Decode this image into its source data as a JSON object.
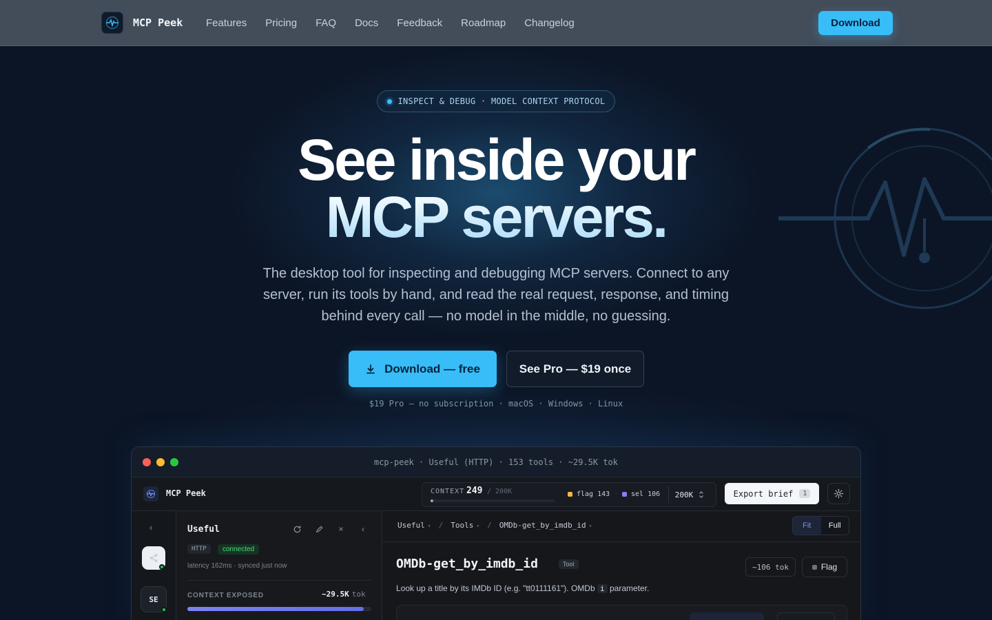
{
  "nav": {
    "brand": "MCP Peek",
    "links": [
      "Features",
      "Pricing",
      "FAQ",
      "Docs",
      "Feedback",
      "Roadmap",
      "Changelog"
    ],
    "download": "Download"
  },
  "hero": {
    "pill": "INSPECT & DEBUG · MODEL CONTEXT PROTOCOL",
    "title_line1": "See inside your",
    "title_line2": "MCP servers.",
    "subtitle": "The desktop tool for inspecting and debugging MCP servers. Connect to any server, run its tools by hand, and read the real request, response, and timing behind every call — no model in the middle, no guessing.",
    "cta_primary": "Download — free",
    "cta_secondary": "See Pro — $19 once",
    "fine_print": "$19 Pro — no subscription · macOS · Windows · Linux"
  },
  "app": {
    "title": "mcp-peek · Useful (HTTP) · 153 tools · ~29.5K tok",
    "name": "MCP Peek",
    "context": {
      "label": "CONTEXT",
      "value": "249",
      "max": "/ 200K",
      "fill": 0.02,
      "flag": "flag 143",
      "sep": "·",
      "sel": "sel 106",
      "limit": "200K",
      "flag_color": "#f5b942",
      "sel_color": "#8b7cf6"
    },
    "export": {
      "label": "Export brief",
      "key": "1"
    },
    "rail": {
      "server2": "SE"
    },
    "server": {
      "name": "Useful",
      "transport": "HTTP",
      "status": "connected",
      "meta": "latency 162ms · synced just now",
      "exposed_label": "CONTEXT EXPOSED",
      "exposed_value": "~29.5K",
      "exposed_unit": "tok",
      "exposed_fill": 0.96
    },
    "breadcrumb": [
      "Useful",
      "Tools",
      "OMDb-get_by_imdb_id"
    ],
    "view": {
      "fit": "Fit",
      "full": "Full"
    },
    "tool": {
      "name": "OMDb-get_by_imdb_id",
      "badge": "Tool",
      "tokens": "~106 tok",
      "flag": "Flag",
      "desc_before": "Look up a title by its IMDb ID (e.g. \"tt0111161\"). OMDb",
      "desc_code": "i",
      "desc_after": "parameter."
    }
  },
  "colors": {
    "accent": "#38bdf8",
    "background": "#0c1526",
    "nav": "#434c59",
    "connected": "#4ade80"
  }
}
